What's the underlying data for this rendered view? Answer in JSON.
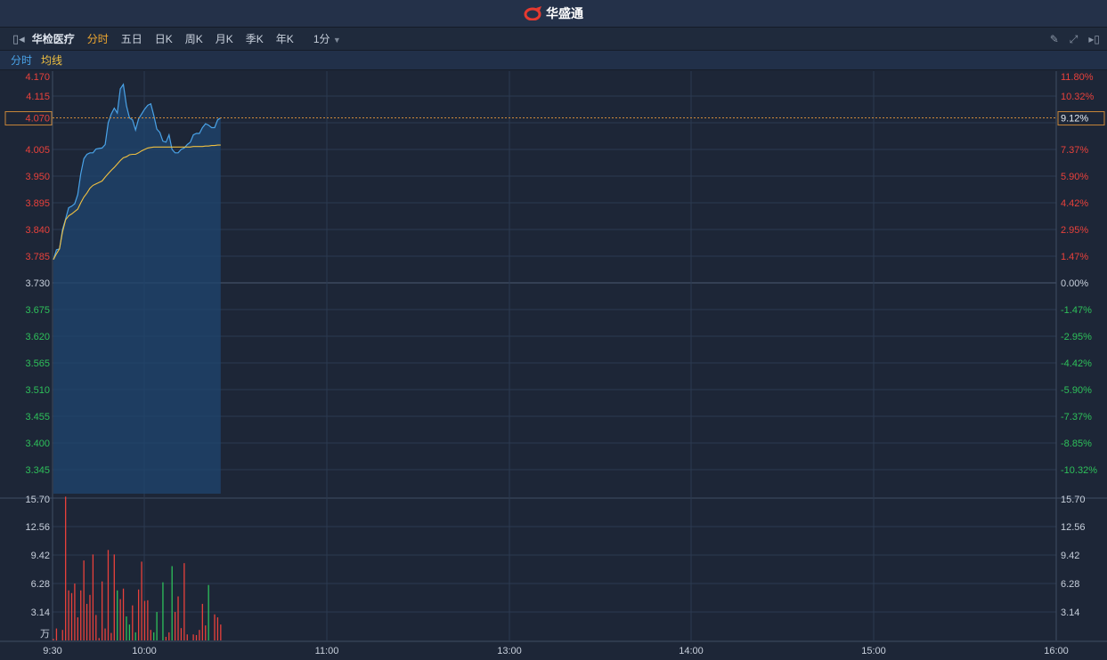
{
  "header": {
    "brand": "华盛通"
  },
  "toolbar": {
    "stock_name": "华检医疗",
    "tabs": [
      {
        "label": "分时",
        "active": true
      },
      {
        "label": "五日"
      },
      {
        "label": "日K"
      },
      {
        "label": "周K"
      },
      {
        "label": "月K"
      },
      {
        "label": "季K"
      },
      {
        "label": "年K"
      }
    ],
    "interval": "1分"
  },
  "legend": {
    "price": "分时",
    "avg": "均线",
    "price_color": "#4aa3e8",
    "avg_color": "#f0c040"
  },
  "colors": {
    "up": "#e8413b",
    "down": "#2ec05a",
    "neutral": "#c8d0dc"
  },
  "current": {
    "price": "4.070",
    "pct": "9.12%",
    "value": 4.07
  },
  "chart_data": {
    "type": "line",
    "title": "华检医疗 分时",
    "prev_close": 3.73,
    "price_ticks": [
      {
        "label": "4.170",
        "c": "up"
      },
      {
        "label": "4.115",
        "c": "up"
      },
      {
        "label": "4.005",
        "c": "up"
      },
      {
        "label": "3.950",
        "c": "up"
      },
      {
        "label": "3.895",
        "c": "up"
      },
      {
        "label": "3.840",
        "c": "up"
      },
      {
        "label": "3.785",
        "c": "up"
      },
      {
        "label": "3.730",
        "c": "neutral"
      },
      {
        "label": "3.675",
        "c": "down"
      },
      {
        "label": "3.620",
        "c": "down"
      },
      {
        "label": "3.565",
        "c": "down"
      },
      {
        "label": "3.510",
        "c": "down"
      },
      {
        "label": "3.455",
        "c": "down"
      },
      {
        "label": "3.400",
        "c": "down"
      },
      {
        "label": "3.345",
        "c": "down"
      }
    ],
    "pct_ticks": [
      {
        "label": "11.80%",
        "c": "up"
      },
      {
        "label": "10.32%",
        "c": "up"
      },
      {
        "label": "7.37%",
        "c": "up"
      },
      {
        "label": "5.90%",
        "c": "up"
      },
      {
        "label": "4.42%",
        "c": "up"
      },
      {
        "label": "2.95%",
        "c": "up"
      },
      {
        "label": "1.47%",
        "c": "up"
      },
      {
        "label": "0.00%",
        "c": "neutral"
      },
      {
        "label": "-1.47%",
        "c": "down"
      },
      {
        "label": "-2.95%",
        "c": "down"
      },
      {
        "label": "-4.42%",
        "c": "down"
      },
      {
        "label": "-5.90%",
        "c": "down"
      },
      {
        "label": "-7.37%",
        "c": "down"
      },
      {
        "label": "-8.85%",
        "c": "down"
      },
      {
        "label": "-10.32%",
        "c": "down"
      }
    ],
    "vol_ticks": [
      "15.70",
      "12.56",
      "9.42",
      "6.28",
      "3.14"
    ],
    "vol_unit": "万",
    "time_ticks": [
      "9:30",
      "10:00",
      "11:00",
      "13:00",
      "14:00",
      "15:00",
      "16:00"
    ],
    "price": [
      3.778,
      3.798,
      3.8,
      3.84,
      3.862,
      3.885,
      3.888,
      3.893,
      3.912,
      3.955,
      3.986,
      3.995,
      3.998,
      3.998,
      4.006,
      4.007,
      4.008,
      4.015,
      4.06,
      4.078,
      4.09,
      4.08,
      4.13,
      4.139,
      4.095,
      4.07,
      4.066,
      4.045,
      4.068,
      4.078,
      4.088,
      4.096,
      4.099,
      4.075,
      4.047,
      4.04,
      4.022,
      4.02,
      4.035,
      4.005,
      3.998,
      3.998,
      4.005,
      4.008,
      4.015,
      4.02,
      4.035,
      4.038,
      4.038,
      4.05,
      4.058,
      4.055,
      4.05,
      4.05,
      4.066,
      4.07
    ],
    "avg": [
      3.778,
      3.79,
      3.8,
      3.835,
      3.86,
      3.868,
      3.872,
      3.877,
      3.882,
      3.895,
      3.907,
      3.915,
      3.925,
      3.931,
      3.934,
      3.937,
      3.94,
      3.948,
      3.955,
      3.962,
      3.968,
      3.975,
      3.982,
      3.988,
      3.99,
      3.994,
      3.995,
      3.995,
      3.998,
      4.002,
      4.005,
      4.008,
      4.009,
      4.01,
      4.01,
      4.01,
      4.01,
      4.01,
      4.01,
      4.01,
      4.01,
      4.01,
      4.01,
      4.01,
      4.01,
      4.01,
      4.011,
      4.011,
      4.011,
      4.011,
      4.012,
      4.012,
      4.013,
      4.013,
      4.014,
      4.014
    ],
    "volume": [
      [
        0,
        0.17,
        "u"
      ],
      [
        1,
        1.33,
        "u"
      ],
      [
        3,
        1.17,
        "u"
      ],
      [
        4,
        16.0,
        "u"
      ],
      [
        5,
        5.57,
        "u"
      ],
      [
        6,
        5.27,
        "u"
      ],
      [
        7,
        6.33,
        "u"
      ],
      [
        8,
        2.57,
        "u"
      ],
      [
        9,
        5.57,
        "u"
      ],
      [
        10,
        8.9,
        "u"
      ],
      [
        11,
        4.07,
        "u"
      ],
      [
        12,
        5.07,
        "u"
      ],
      [
        13,
        9.57,
        "u"
      ],
      [
        14,
        2.83,
        "u"
      ],
      [
        15,
        0.27,
        "u"
      ],
      [
        16,
        6.57,
        "u"
      ],
      [
        17,
        1.33,
        "u"
      ],
      [
        18,
        10.07,
        "u"
      ],
      [
        19,
        0.83,
        "u"
      ],
      [
        20,
        9.57,
        "u"
      ],
      [
        21,
        5.57,
        "d"
      ],
      [
        22,
        4.6,
        "u"
      ],
      [
        23,
        5.77,
        "u"
      ],
      [
        24,
        2.67,
        "d"
      ],
      [
        25,
        1.77,
        "d"
      ],
      [
        26,
        3.9,
        "u"
      ],
      [
        27,
        0.9,
        "d"
      ],
      [
        28,
        5.67,
        "u"
      ],
      [
        29,
        8.77,
        "u"
      ],
      [
        30,
        4.4,
        "u"
      ],
      [
        31,
        4.47,
        "u"
      ],
      [
        32,
        1.17,
        "u"
      ],
      [
        33,
        0.9,
        "d"
      ],
      [
        34,
        3.17,
        "d"
      ],
      [
        36,
        6.47,
        "d"
      ],
      [
        37,
        0.4,
        "u"
      ],
      [
        38,
        0.9,
        "u"
      ],
      [
        39,
        8.27,
        "d"
      ],
      [
        40,
        3.17,
        "u"
      ],
      [
        41,
        4.9,
        "u"
      ],
      [
        42,
        1.37,
        "u"
      ],
      [
        43,
        8.6,
        "u"
      ],
      [
        44,
        0.67,
        "u"
      ],
      [
        46,
        0.67,
        "u"
      ],
      [
        47,
        0.6,
        "u"
      ],
      [
        48,
        1.17,
        "u"
      ],
      [
        49,
        4.07,
        "u"
      ],
      [
        50,
        1.67,
        "u"
      ],
      [
        51,
        6.17,
        "d"
      ],
      [
        53,
        2.9,
        "u"
      ],
      [
        54,
        2.57,
        "u"
      ],
      [
        55,
        1.77,
        "u"
      ]
    ]
  }
}
